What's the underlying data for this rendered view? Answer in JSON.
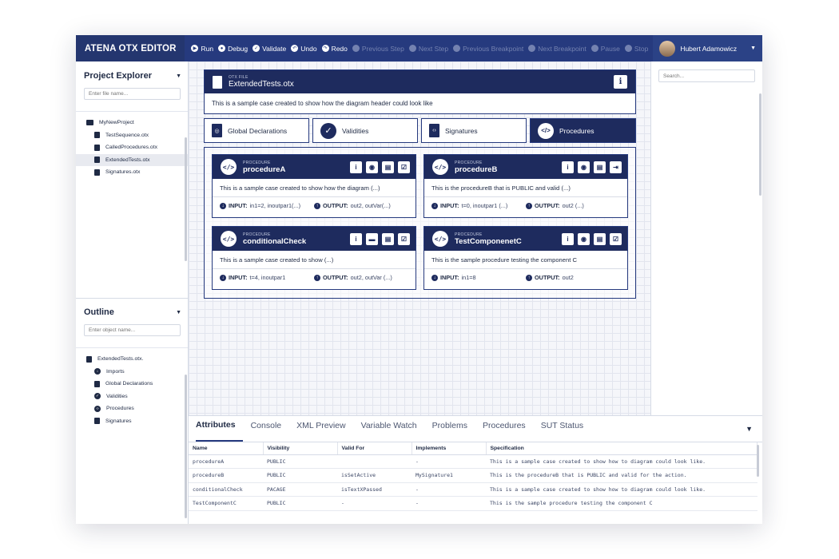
{
  "app": {
    "title": "ATENA OTX EDITOR"
  },
  "toolbar": {
    "items": [
      {
        "label": "Run",
        "enabled": true,
        "icon": "play-icon"
      },
      {
        "label": "Debug",
        "enabled": true,
        "icon": "debug-icon"
      },
      {
        "label": "Validate",
        "enabled": true,
        "icon": "check-icon"
      },
      {
        "label": "Undo",
        "enabled": true,
        "icon": "undo-icon"
      },
      {
        "label": "Redo",
        "enabled": true,
        "icon": "redo-icon"
      },
      {
        "label": "Previous Step",
        "enabled": false,
        "icon": "previous-step-icon"
      },
      {
        "label": "Next Step",
        "enabled": false,
        "icon": "next-step-icon"
      },
      {
        "label": "Previous Breakpoint",
        "enabled": false,
        "icon": "previous-breakpoint-icon"
      },
      {
        "label": "Next Breakpoint",
        "enabled": false,
        "icon": "next-breakpoint-icon"
      },
      {
        "label": "Pause",
        "enabled": false,
        "icon": "pause-icon"
      },
      {
        "label": "Stop",
        "enabled": false,
        "icon": "stop-icon"
      }
    ]
  },
  "user": {
    "name": "Hubert Adamowicz"
  },
  "project_explorer": {
    "title": "Project Explorer",
    "placeholder": "Enter file name...",
    "items": [
      {
        "label": "MyNewProject",
        "type": "folder"
      },
      {
        "label": "TestSequence.otx",
        "type": "file"
      },
      {
        "label": "CalledProcedures.otx",
        "type": "file"
      },
      {
        "label": "ExtendedTests.otx",
        "type": "file",
        "selected": true
      },
      {
        "label": "Signatures.otx",
        "type": "file"
      }
    ]
  },
  "outline": {
    "title": "Outline",
    "placeholder": "Enter object name...",
    "items": [
      {
        "label": "ExtendedTests.otx."
      },
      {
        "label": "Imports"
      },
      {
        "label": "Global Declarations"
      },
      {
        "label": "Validities"
      },
      {
        "label": "Procedures"
      },
      {
        "label": "Signatures"
      }
    ]
  },
  "right_panel": {
    "search_placeholder": "Search..."
  },
  "otx_file": {
    "kicker": "OTX FILE",
    "name": "ExtendedTests.otx",
    "description": "This is a sample case created to show how the diagram header could look like"
  },
  "tabs": [
    {
      "label": "Global Declarations",
      "active": false
    },
    {
      "label": "Validities",
      "active": false
    },
    {
      "label": "Signatures",
      "active": false
    },
    {
      "label": "Procedures",
      "active": true
    }
  ],
  "procedures": [
    {
      "kicker": "PROCEDURE",
      "name": "procedureA",
      "description": "This is a sample case created to show how the diagram (...)",
      "input_label": "INPUT:",
      "input": "in1=2, inoutpar1(...)",
      "output_label": "OUTPUT:",
      "output": "out2, outVar(...)"
    },
    {
      "kicker": "PROCEDURE",
      "name": "procedureB",
      "description": "This is the procedureB that is PUBLIC and valid (...)",
      "input_label": "INPUT:",
      "input": "t=0, inoutpar1 (...)",
      "output_label": "OUTPUT:",
      "output": "out2 (...)"
    },
    {
      "kicker": "PROCEDURE",
      "name": "conditionalCheck",
      "description": "This is a sample case created to show (...)",
      "input_label": "INPUT:",
      "input": "t=4, inoutpar1",
      "output_label": "OUTPUT:",
      "output": "out2, outVar (...)"
    },
    {
      "kicker": "PROCEDURE",
      "name": "TestComponenetC",
      "description": "This is the sample procedure testing the component C",
      "input_label": "INPUT:",
      "input": "in1=8",
      "output_label": "OUTPUT:",
      "output": "out2"
    }
  ],
  "bottom_tabs": [
    {
      "label": "Attributes",
      "active": true
    },
    {
      "label": "Console"
    },
    {
      "label": "XML Preview"
    },
    {
      "label": "Variable Watch"
    },
    {
      "label": "Problems"
    },
    {
      "label": "Procedures"
    },
    {
      "label": "SUT Status"
    }
  ],
  "attributes_table": {
    "columns": [
      "Name",
      "Visibility",
      "Valid For",
      "Implements",
      "Specification"
    ],
    "rows": [
      [
        "procedureA",
        "PUBLIC",
        "",
        "-",
        "This is a sample case created to show how to diagram could look like."
      ],
      [
        "procedureB",
        "PUBLIC",
        "isSetActive",
        "MySignature1",
        "This is the procedureB that is PUBLIC and valid for the action."
      ],
      [
        "conditionalCheck",
        "PACAGE",
        "isTextXPassed",
        "-",
        "This is a sample case created to show how to diagram could look like."
      ],
      [
        "TestComponentC",
        "PUBLIC",
        "-",
        "-",
        "This is the sample procedure testing the component C"
      ]
    ]
  },
  "colors": {
    "navy": "#1e2b5e",
    "topbar": "#263a7e"
  }
}
